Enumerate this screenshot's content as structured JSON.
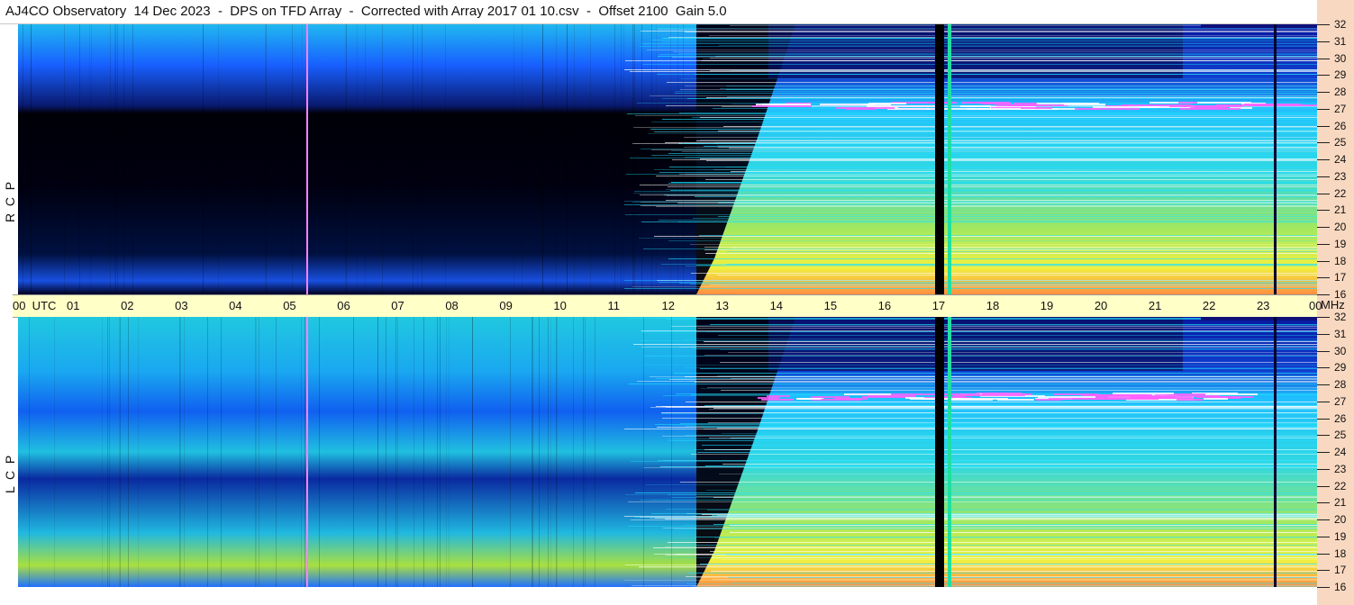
{
  "title": "AJ4CO Observatory  14 Dec 2023  -  DPS on TFD Array  -  Corrected with Array 2017 01 10.csv  -  Offset 2100  Gain 5.0",
  "panels": [
    {
      "label": "R  C  P",
      "name": "rcp"
    },
    {
      "label": "L  C  P",
      "name": "lcp"
    }
  ],
  "time_axis": {
    "ticks": [
      "00  UTC",
      "01",
      "02",
      "03",
      "04",
      "05",
      "06",
      "07",
      "08",
      "09",
      "10",
      "11",
      "12",
      "13",
      "14",
      "15",
      "16",
      "17",
      "18",
      "19",
      "20",
      "21",
      "22",
      "23",
      "00"
    ],
    "unit": "MHz"
  },
  "freq_axis": {
    "ticks": [
      "32",
      "31",
      "30",
      "29",
      "28",
      "27",
      "26",
      "25",
      "24",
      "23",
      "22",
      "21",
      "20",
      "19",
      "18",
      "17",
      "16"
    ]
  },
  "colors": {
    "background_quiet": "#0a1a8a",
    "background_dark": "#000010",
    "spectrum_low": "#1040ff",
    "spectrum_mid": "#20c8ff",
    "spectrum_high": "#c8f040",
    "spectrum_peak": "#ff60ff",
    "axis_band": "#ffffc8",
    "right_band": "#f8d8c0"
  }
}
